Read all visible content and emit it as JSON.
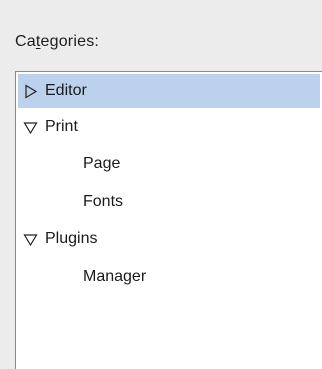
{
  "categories_label": "Categories:",
  "tree": {
    "selection_color": "#bcd1ec",
    "items": [
      {
        "label": "Editor",
        "level": 0,
        "toggle": "collapsed",
        "selected": true
      },
      {
        "label": "Print",
        "level": 0,
        "toggle": "expanded",
        "selected": false
      },
      {
        "label": "Page",
        "level": 1,
        "toggle": "none",
        "selected": false
      },
      {
        "label": "Fonts",
        "level": 1,
        "toggle": "none",
        "selected": false
      },
      {
        "label": "Plugins",
        "level": 0,
        "toggle": "expanded",
        "selected": false
      },
      {
        "label": "Manager",
        "level": 1,
        "toggle": "none",
        "selected": false
      }
    ]
  }
}
